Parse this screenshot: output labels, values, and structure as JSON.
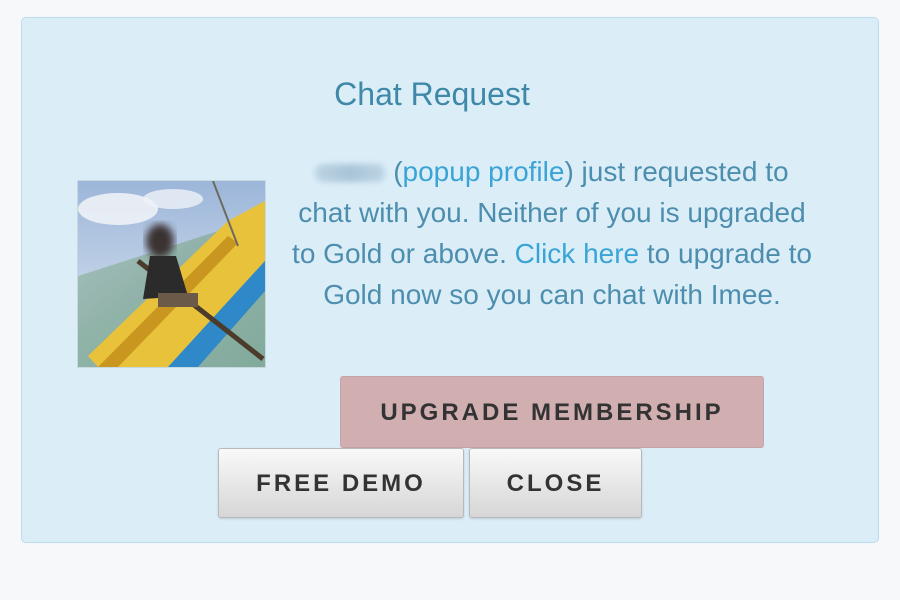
{
  "dialog": {
    "title": "Chat Request",
    "message": {
      "profile_link": "popup profile",
      "part1": ") just requested to chat with you. Neither of you is upgraded to Gold or above.",
      "click_here": "Click here",
      "part2": "to upgrade to Gold now so you can chat with Imee."
    },
    "buttons": {
      "upgrade": "UPGRADE MEMBERSHIP",
      "free_demo": "FREE DEMO",
      "close": "CLOSE"
    }
  },
  "colors": {
    "dialog_bg": "#dbeef8",
    "title": "#3f88a8",
    "text": "#4d8eae",
    "link": "#3aa4d6",
    "upgrade_button": "#d1afb1"
  }
}
